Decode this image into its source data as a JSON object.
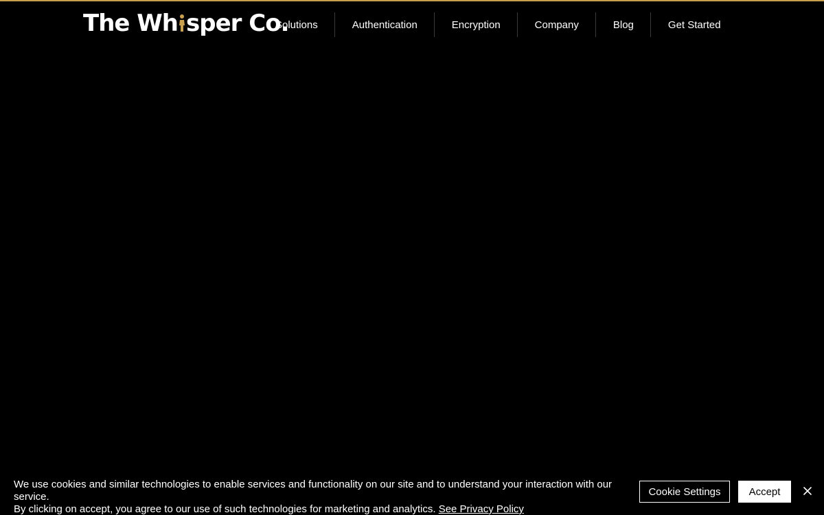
{
  "theme": {
    "background": "#000000",
    "accent": "#c9a04e",
    "text": "#ffffff"
  },
  "header": {
    "logo": {
      "before_i": "The Wh",
      "after_i": "sper Co.",
      "i_icon": "figure-icon"
    },
    "nav": [
      {
        "label": "Solutions"
      },
      {
        "label": "Authentication"
      },
      {
        "label": "Encryption"
      },
      {
        "label": "Company"
      },
      {
        "label": "Blog"
      },
      {
        "label": "Get Started"
      }
    ]
  },
  "cookie_banner": {
    "line1": "We use cookies and similar technologies to enable services and functionality on our site and to understand your interaction with our service.",
    "line2": "By clicking on accept, you agree to our use of such technologies for marketing and analytics.",
    "privacy_link": "See Privacy Policy",
    "settings_label": "Cookie Settings",
    "accept_label": "Accept",
    "close_icon": "close-icon"
  }
}
